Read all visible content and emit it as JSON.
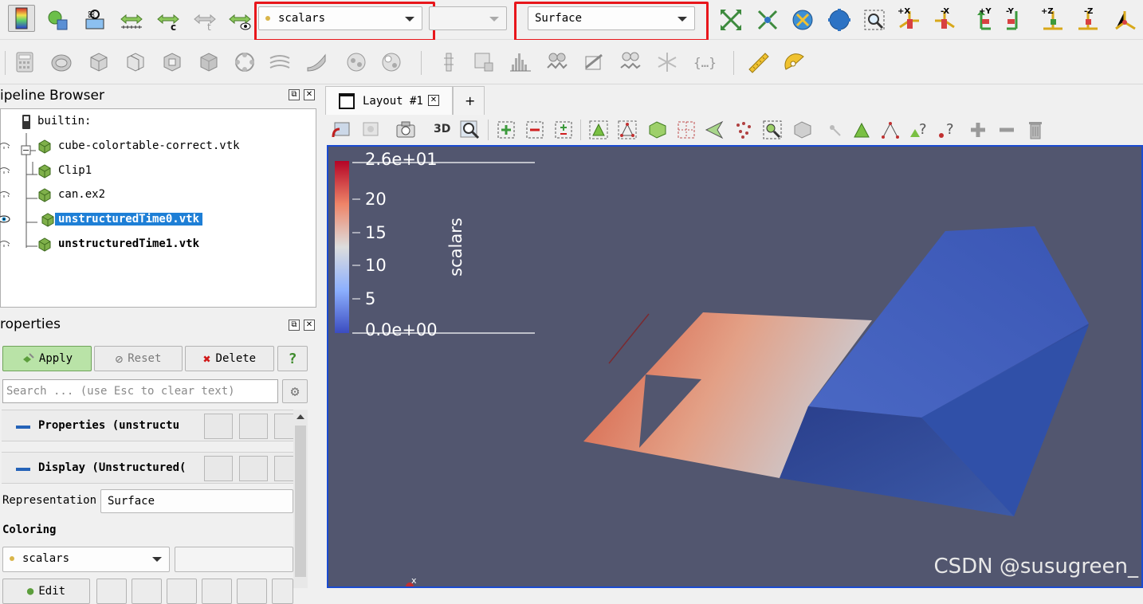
{
  "toolbar": {
    "color_array": "scalars",
    "component": "",
    "representation": "Surface",
    "axis_labels": [
      "+X",
      "-X",
      "+Y",
      "-Y",
      "+Z",
      "-Z"
    ],
    "view_3d_label": "3D"
  },
  "pipeline": {
    "title": "ipeline Browser",
    "items": [
      {
        "label": "builtin:"
      },
      {
        "label": "cube-colortable-correct.vtk"
      },
      {
        "label": "Clip1"
      },
      {
        "label": "can.ex2"
      },
      {
        "label": "unstructuredTime0.vtk"
      },
      {
        "label": "unstructuredTime1.vtk"
      }
    ]
  },
  "properties": {
    "title": "roperties",
    "apply": "Apply",
    "reset": "Reset",
    "delete": "Delete",
    "help": "?",
    "search_placeholder": "Search ... (use Esc to clear text)",
    "section1": "Properties (unstructu",
    "section2": "Display (Unstructured(",
    "representation_label": "Representation",
    "representation_value": "Surface",
    "coloring_label": "Coloring",
    "coloring_value": "scalars",
    "edit_label": "Edit"
  },
  "layout": {
    "tab_label": "Layout #1",
    "add_tab": "+"
  },
  "scalar_bar": {
    "title": "scalars",
    "labels": [
      "2.6e+01",
      "20",
      "15",
      "10",
      "5",
      "0.0e+00"
    ],
    "colors": {
      "high": "#b40426",
      "mid": "#dddddd",
      "low": "#3b4cc0"
    }
  },
  "orientation_axis_label": "x",
  "watermark": "CSDN @susugreen_",
  "colors": {
    "background": "#52566f",
    "selection": "#1e7fd6",
    "highlight_box": "#e8161b",
    "view_border": "#1a4bd1"
  }
}
